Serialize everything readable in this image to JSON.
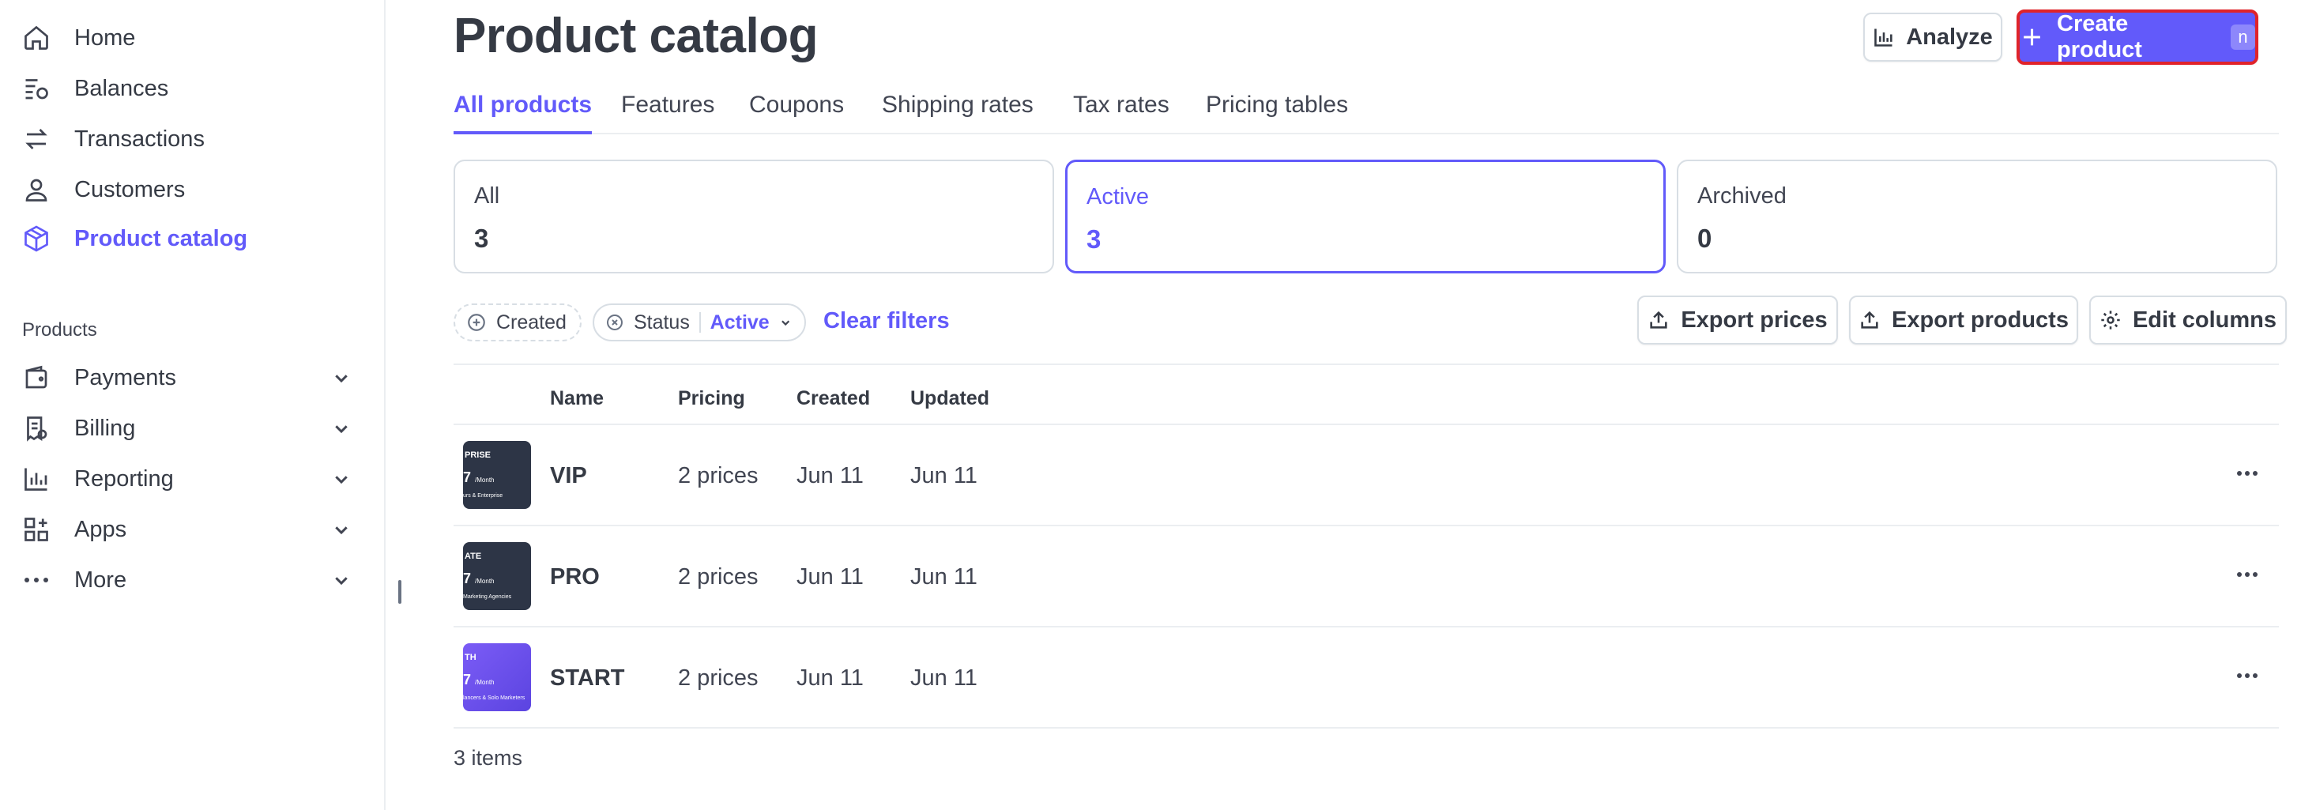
{
  "sidebar": {
    "items": [
      {
        "label": "Home",
        "icon": "home-icon"
      },
      {
        "label": "Balances",
        "icon": "balances-icon"
      },
      {
        "label": "Transactions",
        "icon": "transactions-icon"
      },
      {
        "label": "Customers",
        "icon": "customers-icon"
      },
      {
        "label": "Product catalog",
        "icon": "product-catalog-icon",
        "active": true
      }
    ],
    "section_title": "Products",
    "product_items": [
      {
        "label": "Payments",
        "icon": "payments-icon"
      },
      {
        "label": "Billing",
        "icon": "billing-icon"
      },
      {
        "label": "Reporting",
        "icon": "reporting-icon"
      },
      {
        "label": "Apps",
        "icon": "apps-icon"
      },
      {
        "label": "More",
        "icon": "more-dots-icon"
      }
    ]
  },
  "header": {
    "title": "Product catalog",
    "analyze_label": "Analyze",
    "create_label": "Create product",
    "create_shortcut": "n"
  },
  "tabs": [
    {
      "label": "All products",
      "active": true
    },
    {
      "label": "Features"
    },
    {
      "label": "Coupons"
    },
    {
      "label": "Shipping rates"
    },
    {
      "label": "Tax rates"
    },
    {
      "label": "Pricing tables"
    }
  ],
  "stats": [
    {
      "label": "All",
      "value": "3"
    },
    {
      "label": "Active",
      "value": "3",
      "active": true
    },
    {
      "label": "Archived",
      "value": "0"
    }
  ],
  "filters": {
    "created_label": "Created",
    "status_label": "Status",
    "status_value": "Active",
    "clear_label": "Clear filters"
  },
  "actions": {
    "export_prices": "Export prices",
    "export_products": "Export products",
    "edit_columns": "Edit columns"
  },
  "table": {
    "columns": [
      "Name",
      "Pricing",
      "Created",
      "Updated"
    ],
    "rows": [
      {
        "name": "VIP",
        "pricing": "2 prices",
        "created": "Jun 11",
        "updated": "Jun 11",
        "thumb": {
          "line1": "PRISE",
          "line2": "7",
          "line2_suffix": "/Month",
          "line3": "urs & Enterprise"
        }
      },
      {
        "name": "PRO",
        "pricing": "2 prices",
        "created": "Jun 11",
        "updated": "Jun 11",
        "thumb": {
          "line1": "ATE",
          "line2": "7",
          "line2_suffix": "/Month",
          "line3": "Marketing Agencies"
        }
      },
      {
        "name": "START",
        "pricing": "2 prices",
        "created": "Jun 11",
        "updated": "Jun 11",
        "thumb": {
          "line1": "TH",
          "line2": "7",
          "line2_suffix": "/Month",
          "line3": "lancers & Solo Marketers"
        }
      }
    ]
  },
  "footer": {
    "items_count": "3 items"
  },
  "colors": {
    "accent": "#625afa",
    "highlight_border": "#e0232a",
    "text": "#353a44",
    "border": "#d8dee4"
  }
}
